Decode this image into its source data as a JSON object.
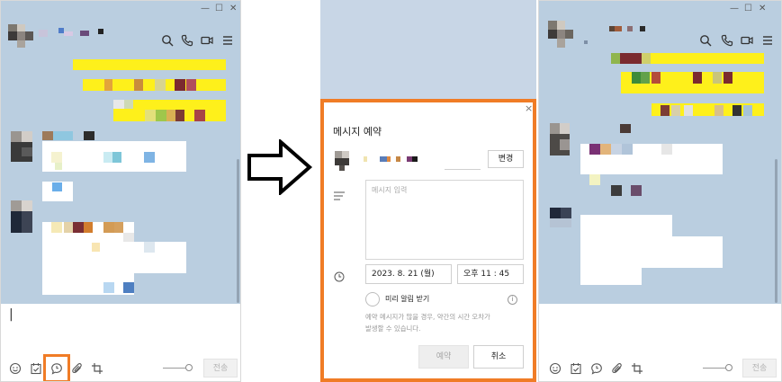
{
  "window_controls": {
    "minimize": "—",
    "maximize": "☐",
    "close": "✕"
  },
  "header_icons": [
    "search-icon",
    "phone-icon",
    "video-icon",
    "menu-icon"
  ],
  "composer": {
    "send_label": "전송",
    "caret": "|"
  },
  "bottom_icons": [
    "emoji-icon",
    "calendar-check-icon",
    "schedule-message-icon",
    "attach-icon",
    "crop-icon"
  ],
  "dialog": {
    "title": "메시지 예약",
    "close": "×",
    "change_button": "변경",
    "message_placeholder": "메시지 입력",
    "date": "2023. 8. 21 (월)",
    "time": "오후 11 : 45",
    "reminder_label": "미리 알림 받기",
    "notice_line1": "예약 메시지가 많을 경우, 약간의 시간 오차가",
    "notice_line2": "발생할 수 있습니다.",
    "reserve_button": "예약",
    "cancel_button": "취소"
  },
  "colors": {
    "chat_background": "#bacee0",
    "my_bubble": "#fef01b",
    "highlight": "#f07c26"
  }
}
